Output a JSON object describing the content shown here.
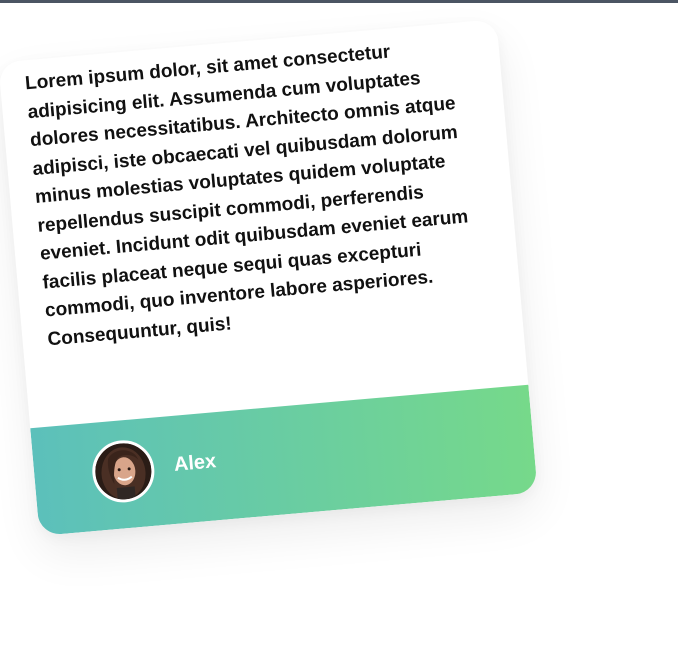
{
  "testimonial": {
    "quote": "Lorem ipsum dolor, sit amet consectetur adipisicing elit. Assumenda cum voluptates dolores necessitatibus. Architecto omnis atque adipisci, iste obcaecati vel quibusdam dolorum minus molestias voluptates quidem voluptate repellendus suscipit commodi, perferendis eveniet. Incidunt odit quibusdam eveniet earum facilis placeat neque sequi quas excepturi commodi, quo inventore labore asperiores. Consequuntur, quis!",
    "author_name": "Alex",
    "colors": {
      "gradient_start": "#5cc0bb",
      "gradient_end": "#76d98a"
    }
  }
}
